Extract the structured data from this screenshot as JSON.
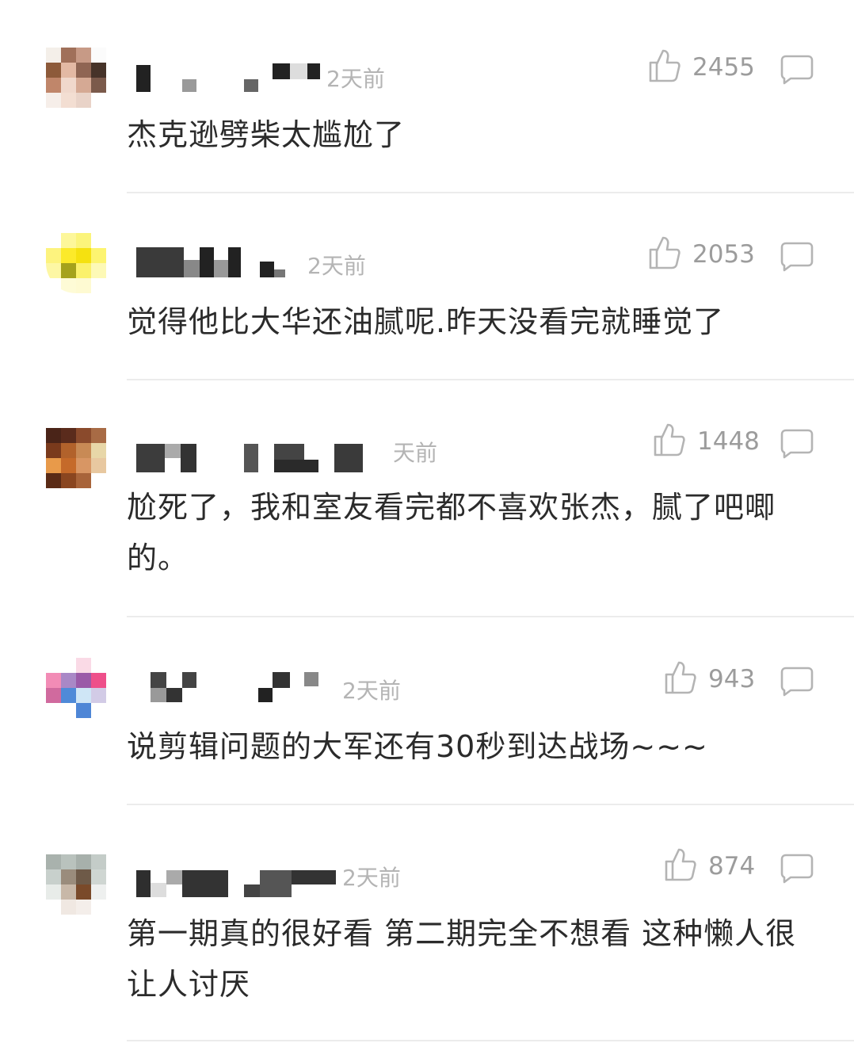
{
  "comments": [
    {
      "time": "2天前",
      "likes": "2455",
      "text": "杰克逊劈柴太尴尬了"
    },
    {
      "time": "2天前",
      "likes": "2053",
      "text": "觉得他比大华还油腻呢.昨天没看完就睡觉了"
    },
    {
      "time": "天前",
      "likes": "1448",
      "text": "尬死了，我和室友看完都不喜欢张杰，腻了吧唧的。"
    },
    {
      "time": "2天前",
      "likes": "943",
      "text": "说剪辑问题的大军还有30秒到达战场~~~"
    },
    {
      "time": "2天前",
      "likes": "874",
      "text": "第一期真的很好看 第二期完全不想看 这种懒人很让人讨厌"
    }
  ],
  "icons": {
    "like": "thumbs-up-icon",
    "reply": "speech-bubble-icon"
  },
  "colors": {
    "text": "#2b2b2b",
    "meta": "#b4b4b4",
    "count": "#9c9c9c",
    "divider": "#ececec"
  }
}
